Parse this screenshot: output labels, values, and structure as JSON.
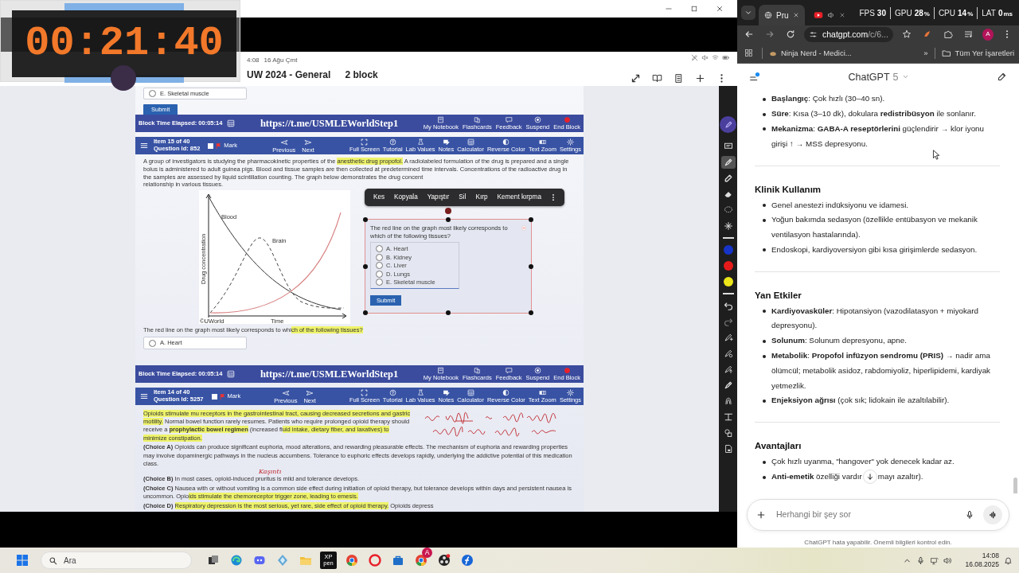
{
  "timer": {
    "time": "00:21:40"
  },
  "left_window": {
    "status_time": "4:08",
    "status_date": "16 Ağu Çmt",
    "title_parts": [
      "UW 2024 - General",
      "2 block"
    ]
  },
  "annotation_tools": [
    {
      "selected": false
    },
    {
      "selected": true
    },
    {
      "selected": false
    },
    {
      "selected": false
    },
    {
      "selected": false
    },
    {
      "selected": false
    }
  ],
  "annotation_colors": [
    {
      "color": "#1634c8"
    },
    {
      "color": "#e51b1b"
    },
    {
      "color": "#ece51a"
    }
  ],
  "exam": {
    "prev_option": {
      "label": "E. Skeletal muscle",
      "selected": false
    },
    "prev_submit": "Submit",
    "block_bars": [
      {
        "elapsed": "Block Time Elapsed: 00:05:14",
        "url": "https://t.me/USMLEWorldStep1",
        "buttons": [
          "My Notebook",
          "Flashcards",
          "Feedback",
          "Suspend",
          "End Block"
        ]
      },
      {
        "elapsed": "Block Time Elapsed: 00:05:14",
        "url": "https://t.me/USMLEWorldStep1",
        "buttons": [
          "My Notebook",
          "Flashcards",
          "Feedback",
          "Suspend",
          "End Block"
        ]
      }
    ],
    "question_toolbars": [
      {
        "item": "Item 15 of 40",
        "question_id": "Question Id: 852",
        "mark": "Mark",
        "marked": false,
        "nav": [
          "Previous",
          "Next"
        ],
        "tools": [
          "Full Screen",
          "Tutorial",
          "Lab Values",
          "Notes",
          "Calculator",
          "Reverse Color",
          "Text Zoom",
          "Settings"
        ]
      },
      {
        "item": "Item 14 of 40",
        "question_id": "Question Id: 5257",
        "mark": "Mark",
        "marked": false,
        "nav": [
          "Previous",
          "Next"
        ],
        "tools": [
          "Full Screen",
          "Tutorial",
          "Lab Values",
          "Notes",
          "Calculator",
          "Reverse Color",
          "Text Zoom",
          "Settings"
        ]
      }
    ],
    "stem": [
      {
        "text": "A group of investigators is studying the pharmacokinetic properties of the ",
        "highlighted": false
      },
      {
        "text": "anesthetic drug propofol.",
        "highlighted": true
      },
      {
        "text": "  A radiolabeled formulation of the drug is prepared and a single bolus is administered to adult guinea pigs.  Blood and tissue samples are then collected at predetermined time intervals.  Concentrations of the radioactive drug in the samples are assessed by liquid scintillation counting.  The graph below demonstrates the drug concent",
        "highlighted": false
      }
    ],
    "stem_tail": "relationship in various tissues.",
    "chart_labels": {
      "y_axis": "Drug concentration",
      "x_axis": "Time",
      "curves": [
        "Blood",
        "Brain"
      ],
      "credit": "©UWorld"
    },
    "question": [
      {
        "text": "The red line on the graph most likely corresponds to whi",
        "highlighted": false
      },
      {
        "text": "ch of the following tissues?",
        "highlighted": true
      }
    ],
    "visible_option": {
      "label": "A. Heart",
      "selected": false
    },
    "context_menu": [
      "Kes",
      "Kopyala",
      "Yapıştır",
      "Sil",
      "Kırp",
      "Kement kırpma"
    ],
    "clip": {
      "question": "The red line on the graph most likely corresponds to which of the following tissues?",
      "options": [
        {
          "label": "A. Heart",
          "selected": false
        },
        {
          "label": "B. Kidney",
          "selected": false
        },
        {
          "label": "C. Liver",
          "selected": false
        },
        {
          "label": "D. Lungs",
          "selected": false
        },
        {
          "label": "E. Skeletal muscle",
          "selected": false
        }
      ],
      "submit": "Submit"
    },
    "explanation": [
      [
        {
          "text": "Opioids stimulate mu receptors in the gastrointestinal tract, causing decreased secretions and gastric motility.",
          "highlighted": true
        },
        {
          "text": "  Normal bowel function rarely resumes.  Patients who require prolonged opioid therapy should receive a ",
          "highlighted": false
        },
        {
          "text": "**prophylactic bowel regimen**",
          "highlighted": true
        },
        {
          "text": " (increased fl",
          "highlighted": false
        },
        {
          "text": "uid intake, dietary fiber, and laxatives) to minimize constipation.",
          "highlighted": true
        }
      ],
      [
        {
          "text": "**(Choice A)**  Opioids can produce significant euphoria, mood alterations, and rewarding pleasurable effects.  The mechanism of euphoria and rewarding properties may involve dopaminergic pathways in the nucleus accumbens.  Tolerance to euphoric effects develops rapidly, underlying the addictive potential of this medication class.",
          "highlighted": false
        }
      ],
      [
        {
          "text": "**(Choice B)**  In most cases, opioid-induced ",
          "highlighted": false
        },
        {
          "text": "pruritus",
          "highlighted": false,
          "note": "Kaşıntı"
        },
        {
          "text": " is mild and tolerance develops.",
          "highlighted": false
        }
      ],
      [
        {
          "text": "**(Choice C)**  Nausea with or without vomiting is a common side effect during initiation of opioid therapy, but tolerance develops within days and persistent nausea is uncommon.  Opio",
          "highlighted": false
        },
        {
          "text": "ids stimulate the chemoreceptor trigger zone, leading to emesis.",
          "highlighted": true
        }
      ],
      [
        {
          "text": "**(Choice D)**  ",
          "highlighted": false
        },
        {
          "text": "Respiratory depression is the most serious, yet rare, side effect of opioid therapy.",
          "highlighted": true
        },
        {
          "text": "  Opioids depress",
          "highlighted": false
        }
      ]
    ]
  },
  "browser": {
    "tabs": [
      {
        "title": "Pru",
        "selected": true,
        "audio": false
      },
      {
        "selected": false,
        "audio": true
      }
    ],
    "perf": [
      {
        "label": "FPS",
        "value": "30"
      },
      {
        "label": "GPU",
        "value": "28",
        "unit": "%"
      },
      {
        "label": "CPU",
        "value": "14",
        "unit": "%"
      },
      {
        "label": "LAT",
        "value": "0",
        "unit": "ms"
      }
    ],
    "url_host": "chatgpt.com",
    "url_path": "/c/6...",
    "profile": "A",
    "bookmark": "Ninja Nerd - Medici...",
    "overflow": "»",
    "all_bookmarks": "Tüm Yer İşaretleri"
  },
  "chat": {
    "title": "ChatGPT",
    "model": "5",
    "sections": [
      {
        "items": [
          "**Başlangıç**: Çok hızlı (30–40 sn).",
          "**Süre**: Kısa (3–10 dk), dokulara **redistribüsyon** ile sonlanır.",
          "**Mekanizma**: **GABA-A reseptörlerini** güçlendirir → klor iyonu girişi ↑ → MSS depresyonu."
        ]
      },
      {
        "heading": "Klinik Kullanım",
        "items": [
          "Genel anestezi indüksiyonu ve idamesi.",
          "Yoğun bakımda sedasyon (özellikle entübasyon ve mekanik ventilasyon hastalarında).",
          "Endoskopi, kardiyoversiyon gibi kısa girişimlerde sedasyon."
        ]
      },
      {
        "heading": "Yan Etkiler",
        "items": [
          "**Kardiyovasküler**: Hipotansiyon (vazodilatasyon + miyokard depresyonu).",
          "**Solunum**: Solunum depresyonu, apne.",
          "**Metabolik**: **Propofol infüzyon sendromu (PRIS)** → nadir ama ölümcül; metabolik asidoz, rabdomiyoliz, hiperlipidemi, kardiyak yetmezlik.",
          "**Enjeksiyon ağrısı** (çok sık; lidokain ile azaltılabilir)."
        ]
      },
      {
        "heading": "Avantajları",
        "items": [
          "Çok hızlı uyanma, \"hangover\" yok denecek kadar az.",
          "**Anti-emetik** özelliği vardır"
        ],
        "last_item_tail": "mayı azaltır)."
      }
    ],
    "input_placeholder": "Herhangi bir şey sor",
    "disclaimer": "ChatGPT hata yapabilir. Önemli bilgileri kontrol edin."
  },
  "taskbar": {
    "search_placeholder": "Ara",
    "pen_app_logo": "XP pen",
    "browser_badge": "A",
    "time": "14:08",
    "date": "16.08.2025"
  }
}
